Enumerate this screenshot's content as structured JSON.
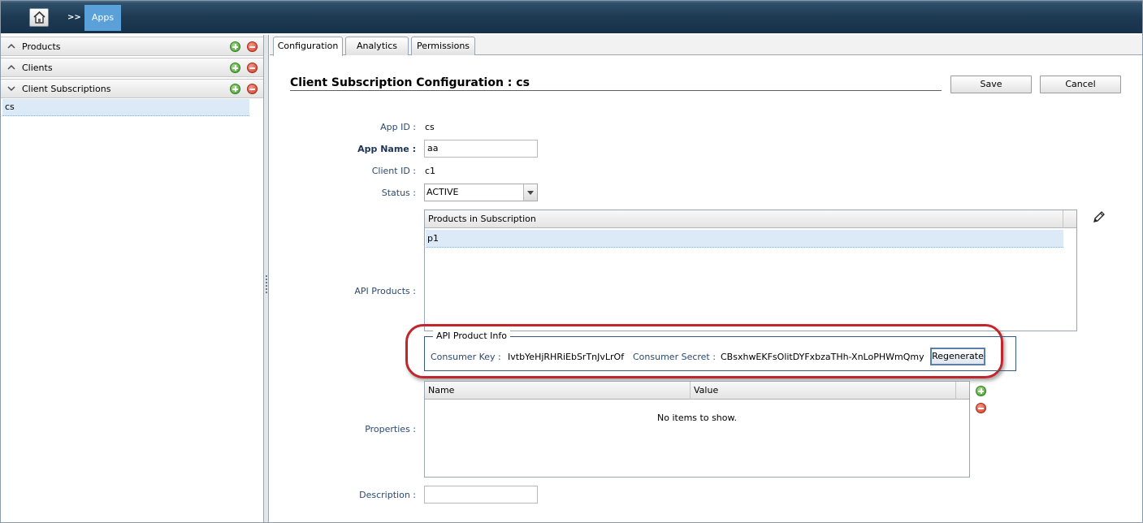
{
  "topbar": {
    "home_icon": "home-icon",
    "breadcrumb_separator": ">>",
    "breadcrumb_current": "Apps"
  },
  "sidebar": {
    "sections": [
      {
        "label": "Products",
        "state": "collapsed"
      },
      {
        "label": "Clients",
        "state": "collapsed"
      },
      {
        "label": "Client Subscriptions",
        "state": "expanded"
      }
    ],
    "items": [
      {
        "label": "cs",
        "selected": true
      }
    ]
  },
  "tabs": [
    {
      "label": "Configuration",
      "active": true
    },
    {
      "label": "Analytics",
      "active": false
    },
    {
      "label": "Permissions",
      "active": false
    }
  ],
  "form": {
    "title": "Client Subscription Configuration : cs",
    "save_label": "Save",
    "cancel_label": "Cancel",
    "app_id_label": "App ID :",
    "app_id_value": "cs",
    "app_name_label": "App Name :",
    "app_name_value": "aa",
    "client_id_label": "Client ID :",
    "client_id_value": "c1",
    "status_label": "Status :",
    "status_value": "ACTIVE",
    "api_products_label": "API Products :",
    "products_grid": {
      "header": "Products in Subscription",
      "rows": [
        "p1"
      ]
    },
    "api_product_info": {
      "legend": "API Product Info",
      "consumer_key_label": "Consumer Key :",
      "consumer_key_value": "IvtbYeHjRHRiEbSrTnJvLrOf",
      "consumer_secret_label": "Consumer Secret :",
      "consumer_secret_value": "CBsxhwEKFsOlitDYFxbzaTHh-XnLoPHWmQmy",
      "regenerate_label": "Regenerate"
    },
    "properties_label": "Properties :",
    "properties_grid": {
      "columns": [
        "Name",
        "Value"
      ],
      "empty_text": "No items to show."
    },
    "description_label": "Description :",
    "description_value": ""
  },
  "colors": {
    "topbar": "#1d3a52",
    "breadcrumb_active": "#5aa0d9",
    "label_blue": "#2a4a72",
    "selection": "#dce9f7",
    "highlight_oval": "#c0272d"
  }
}
